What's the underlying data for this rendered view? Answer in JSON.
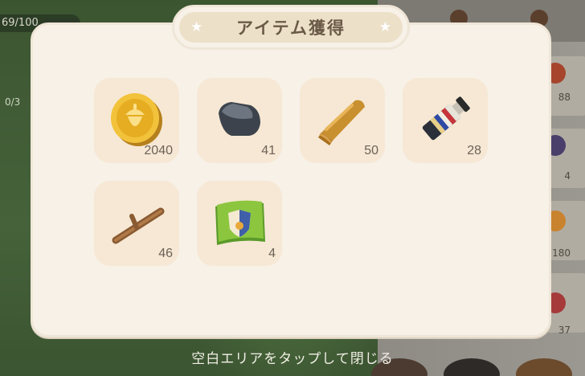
{
  "hud": {
    "hp": "69/100",
    "progress": "0/3"
  },
  "shelf": {
    "counts": [
      "88",
      "4",
      "180",
      "37"
    ]
  },
  "dialog": {
    "title": "アイテム獲得",
    "items": [
      {
        "icon": "gold-acorn-coin-icon",
        "count": "2040"
      },
      {
        "icon": "stone-icon",
        "count": "41"
      },
      {
        "icon": "wood-plank-icon",
        "count": "50"
      },
      {
        "icon": "paint-tube-icon",
        "count": "28"
      },
      {
        "icon": "branch-icon",
        "count": "46"
      },
      {
        "icon": "green-emblem-flag-icon",
        "count": "4"
      }
    ]
  },
  "footer": {
    "hint": "空白エリアをタップして閉じる"
  },
  "colors": {
    "panel": "#f7f1e8",
    "slot": "#f6e8d4",
    "title_band": "#ece0c9",
    "title_text": "#6b5a47",
    "count_text": "#6d6258"
  }
}
